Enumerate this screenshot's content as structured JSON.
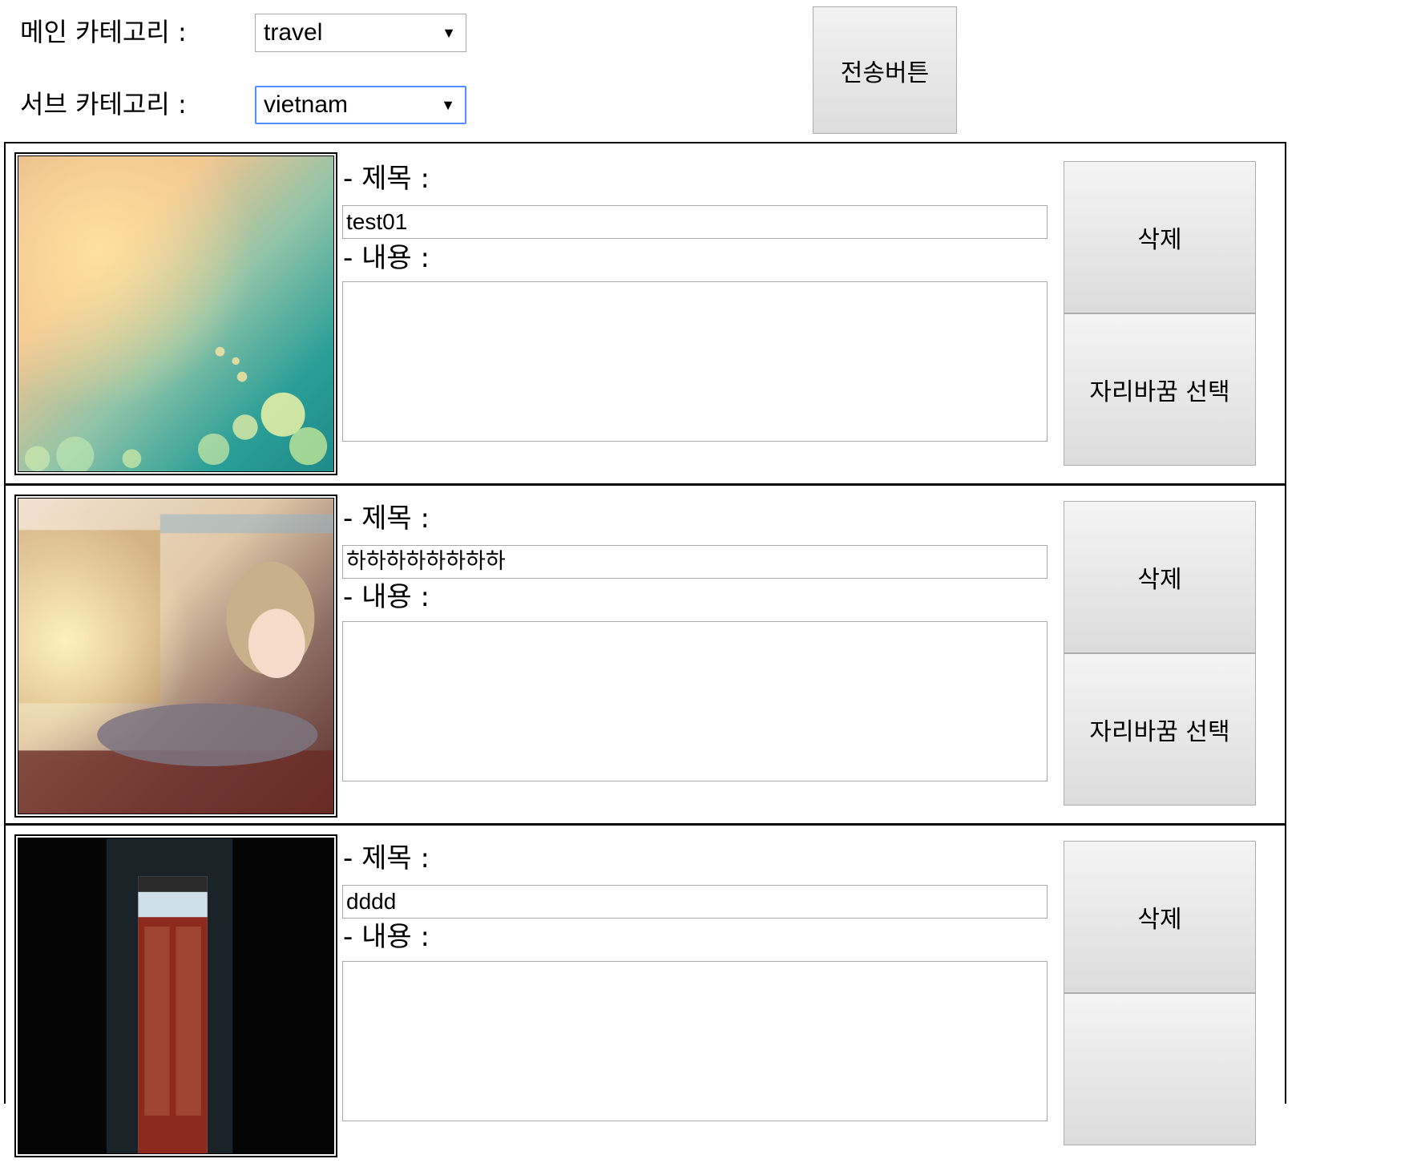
{
  "form": {
    "main_category_label": "메인 카테고리 :",
    "main_category_value": "travel",
    "sub_category_label": "서브 카테고리 :",
    "sub_category_value": "vietnam",
    "select_arrow": "▼",
    "send_button": "전송버튼"
  },
  "posts": [
    {
      "title_label": "- 제목 :",
      "title_value": "test01",
      "content_label": "- 내용 :",
      "content_value": "",
      "delete_button": "삭제",
      "swap_button": "자리바꿈 선택"
    },
    {
      "title_label": "- 제목 :",
      "title_value": "하하하하하하하하",
      "content_label": "- 내용 :",
      "content_value": "",
      "delete_button": "삭제",
      "swap_button": "자리바꿈 선택"
    },
    {
      "title_label": "- 제목 :",
      "title_value": "dddd",
      "content_label": "- 내용 :",
      "content_value": "",
      "delete_button": "삭제",
      "swap_button": ""
    }
  ]
}
